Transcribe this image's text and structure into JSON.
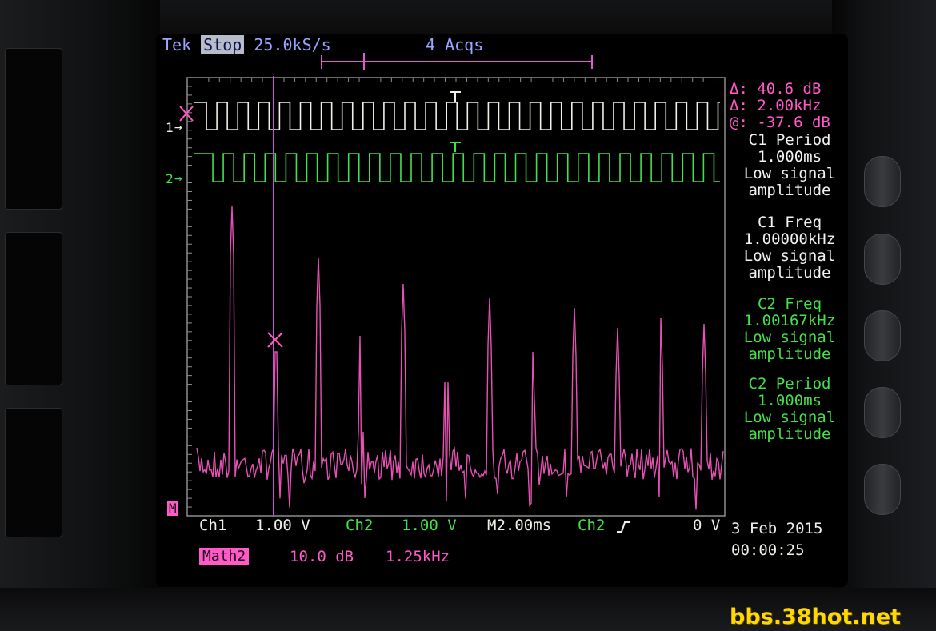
{
  "status": {
    "brand": "Tek",
    "run_state": "Stop",
    "sample_rate": "25.0kS/s",
    "acquisitions": "4 Acqs"
  },
  "readouts": [
    {
      "text": "Δ: 40.6 dB",
      "color": "#ff5ac8"
    },
    {
      "text": "Δ: 2.00kHz",
      "color": "#ff5ac8"
    },
    {
      "text": "@: -37.6 dB",
      "color": "#ff5ac8"
    },
    {
      "text": "C1 Period",
      "color": "#f2f2f2"
    },
    {
      "text": "1.000ms",
      "color": "#f2f2f2"
    },
    {
      "text": "Low signal",
      "color": "#f2f2f2"
    },
    {
      "text": "amplitude",
      "color": "#f2f2f2"
    },
    {
      "text": "C1 Freq",
      "color": "#f2f2f2"
    },
    {
      "text": "1.00000kHz",
      "color": "#f2f2f2"
    },
    {
      "text": "Low signal",
      "color": "#f2f2f2"
    },
    {
      "text": "amplitude",
      "color": "#f2f2f2"
    },
    {
      "text": "C2 Freq",
      "color": "#41e24a"
    },
    {
      "text": "1.00167kHz",
      "color": "#41e24a"
    },
    {
      "text": "Low signal",
      "color": "#41e24a"
    },
    {
      "text": "amplitude",
      "color": "#41e24a"
    },
    {
      "text": "C2 Period",
      "color": "#41e24a"
    },
    {
      "text": "1.000ms",
      "color": "#41e24a"
    },
    {
      "text": "Low signal",
      "color": "#41e24a"
    },
    {
      "text": "amplitude",
      "color": "#41e24a"
    }
  ],
  "channels": {
    "ch1": {
      "label": "Ch1",
      "scale": "1.00 V",
      "marker": "1",
      "color": "#f0efe8"
    },
    "ch2": {
      "label": "Ch2",
      "scale": "1.00 V",
      "marker": "2",
      "color": "#43e04a"
    },
    "math": {
      "label": "Math2",
      "scale": "10.0 dB",
      "span": "1.25kHz",
      "marker": "M",
      "color": "#ff5ac8"
    }
  },
  "timebase": "M2.00ms",
  "trigger": {
    "source": "Ch2",
    "slope_icon": "rising-edge-icon",
    "level": "0 V"
  },
  "datetime": {
    "date": "3 Feb 2015",
    "time": "00:00:25"
  },
  "watermark": "bbs.38hot.net"
}
